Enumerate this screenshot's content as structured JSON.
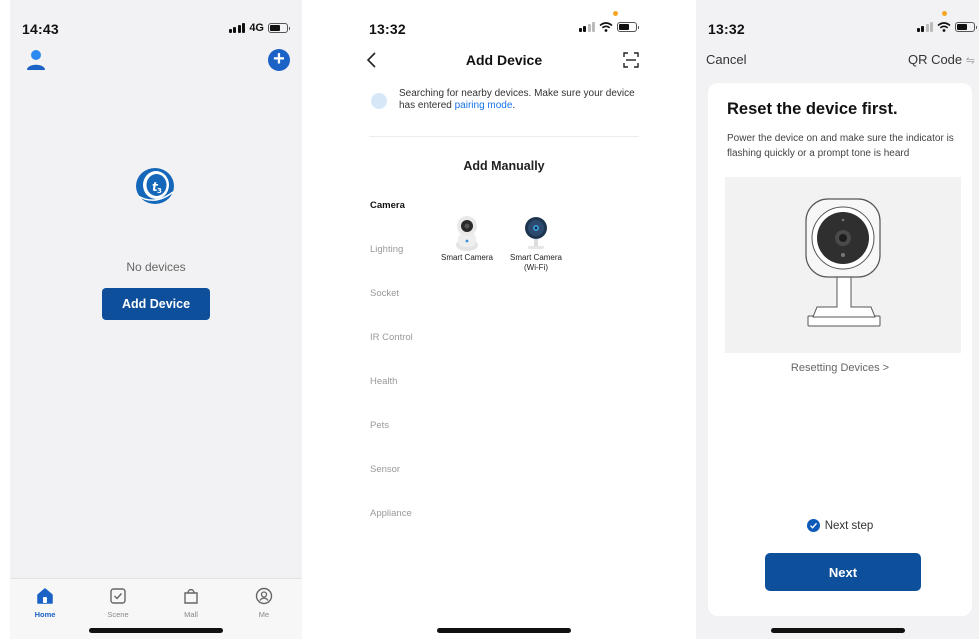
{
  "screen1": {
    "status": {
      "time": "14:43",
      "network": "4G"
    },
    "empty_text": "No devices",
    "add_device_label": "Add Device",
    "plus_icon": "plus-circle-icon",
    "tabs": [
      {
        "label": "Home",
        "icon": "home-icon",
        "active": true
      },
      {
        "label": "Scene",
        "icon": "scene-check-icon",
        "active": false
      },
      {
        "label": "Mall",
        "icon": "shopping-bag-icon",
        "active": false
      },
      {
        "label": "Me",
        "icon": "profile-icon",
        "active": false
      }
    ]
  },
  "screen2": {
    "status": {
      "time": "13:32"
    },
    "title": "Add Device",
    "search_note_prefix": "Searching for nearby devices. Make sure your device has entered",
    "search_note_link": "pairing mode",
    "search_note_suffix": ".",
    "section_title": "Add Manually",
    "categories": [
      "Camera",
      "Lighting",
      "Socket",
      "IR Control",
      "Health",
      "Pets",
      "Sensor",
      "Appliance"
    ],
    "selected_category": "Camera",
    "products": [
      {
        "label": "Smart Camera"
      },
      {
        "label": "Smart Camera (Wi-Fi)"
      }
    ]
  },
  "screen3": {
    "status": {
      "time": "13:32"
    },
    "cancel_label": "Cancel",
    "qr_label": "QR Code",
    "qr_icon": "⇋",
    "title": "Reset the device first.",
    "description": "Power the device on and make sure the indicator is flashing quickly or a prompt tone is heard",
    "resetting_link": "Resetting Devices >",
    "next_step_label": "Next step",
    "next_step_checked": true,
    "next_button": "Next"
  },
  "colors": {
    "primary": "#0d4f9b",
    "accent": "#1a62c6",
    "link": "#1a73e8",
    "background": "#f2f2f4"
  }
}
